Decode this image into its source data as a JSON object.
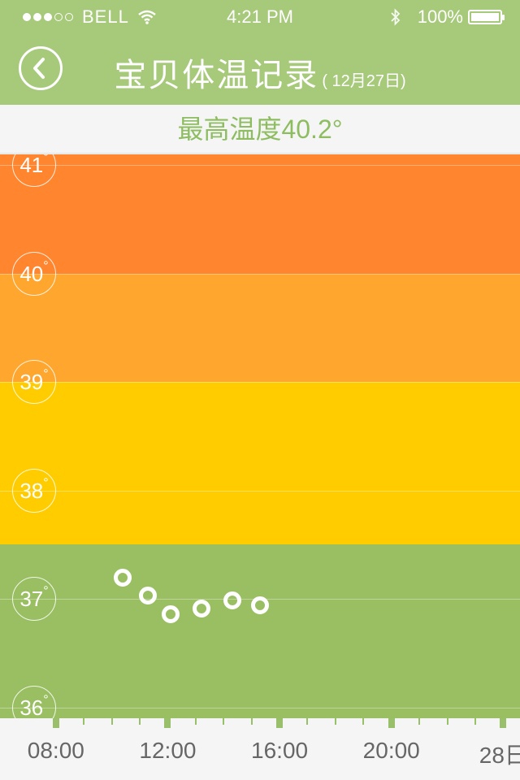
{
  "status_bar": {
    "carrier": "BELL",
    "time": "4:21 PM",
    "battery": "100%",
    "signal_icon": "signal-dots-icon",
    "wifi_icon": "wifi-icon",
    "bluetooth_icon": "bluetooth-icon",
    "battery_icon": "battery-icon"
  },
  "nav": {
    "back_icon": "chevron-left-icon",
    "title": "宝贝体温记录",
    "date": "( 12月27日)"
  },
  "summary": {
    "max_label": "最高温度40.2°"
  },
  "colors": {
    "header": "#a6c97a",
    "band_41": "#ff852e",
    "band_40": "#ffa62e",
    "band_38_39": "#ffcc00",
    "band_normal": "#9abf62",
    "accent_text": "#8ebd61"
  },
  "chart_data": {
    "type": "scatter",
    "title": "",
    "xlabel": "",
    "ylabel": "",
    "y_unit": "°",
    "ylim": [
      35.9,
      41.1
    ],
    "yticks": [
      "36",
      "37",
      "38",
      "39",
      "40",
      "41"
    ],
    "xlim": [
      6.0,
      24.6
    ],
    "x_ticks": [
      {
        "x": 8,
        "label": "08:00"
      },
      {
        "x": 12,
        "label": "12:00"
      },
      {
        "x": 16,
        "label": "16:00"
      },
      {
        "x": 20,
        "label": "20:00"
      },
      {
        "x": 24,
        "label": "28日"
      }
    ],
    "bands": [
      {
        "from": 40.0,
        "to": 41.1,
        "color": "#ff852e"
      },
      {
        "from": 39.0,
        "to": 40.0,
        "color": "#ffa62e"
      },
      {
        "from": 37.5,
        "to": 39.0,
        "color": "#ffcc00"
      },
      {
        "from": 35.9,
        "to": 37.5,
        "color": "#9abf62"
      }
    ],
    "series": [
      {
        "points": [
          {
            "x": 10.4,
            "y": 37.2
          },
          {
            "x": 11.3,
            "y": 37.03
          },
          {
            "x": 12.1,
            "y": 36.86
          },
          {
            "x": 13.2,
            "y": 36.91
          },
          {
            "x": 14.3,
            "y": 36.99
          },
          {
            "x": 15.3,
            "y": 36.94
          }
        ]
      }
    ]
  }
}
